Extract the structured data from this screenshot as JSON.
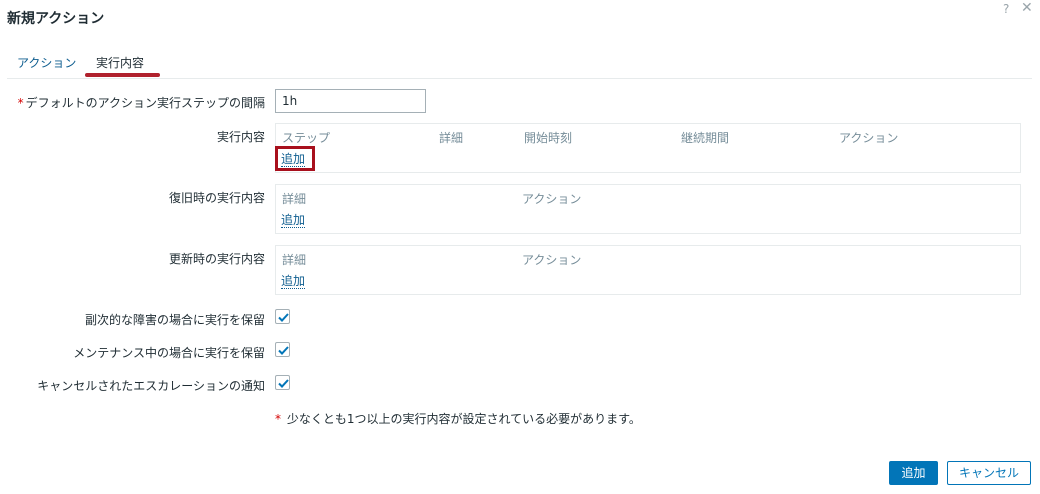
{
  "dialog": {
    "title": "新規アクション",
    "help": "?",
    "close": "✕"
  },
  "tabs": [
    {
      "label": "アクション",
      "active": false
    },
    {
      "label": "実行内容",
      "active": true
    }
  ],
  "form": {
    "step_duration": {
      "required_mark": "*",
      "label": "デフォルトのアクション実行ステップの間隔",
      "value": "1h"
    },
    "operations": {
      "label": "実行内容",
      "columns": [
        "ステップ",
        "詳細",
        "開始時刻",
        "継続期間",
        "アクション"
      ],
      "add_label": "追加"
    },
    "recovery_operations": {
      "label": "復旧時の実行内容",
      "columns": [
        "詳細",
        "アクション"
      ],
      "add_label": "追加"
    },
    "update_operations": {
      "label": "更新時の実行内容",
      "columns": [
        "詳細",
        "アクション"
      ],
      "add_label": "追加"
    },
    "checkboxes": [
      {
        "label": "副次的な障害の場合に実行を保留",
        "checked": true
      },
      {
        "label": "メンテナンス中の場合に実行を保留",
        "checked": true
      },
      {
        "label": "キャンセルされたエスカレーションの通知",
        "checked": true
      }
    ],
    "note": {
      "required_mark": "*",
      "text": "少なくとも1つ以上の実行内容が設定されている必要があります。"
    }
  },
  "footer": {
    "add_label": "追加",
    "cancel_label": "キャンセル"
  },
  "colors": {
    "link": "#0e5d8f",
    "primary": "#0275b8",
    "tab_highlight": "#b0212d",
    "required": "#d40000"
  }
}
